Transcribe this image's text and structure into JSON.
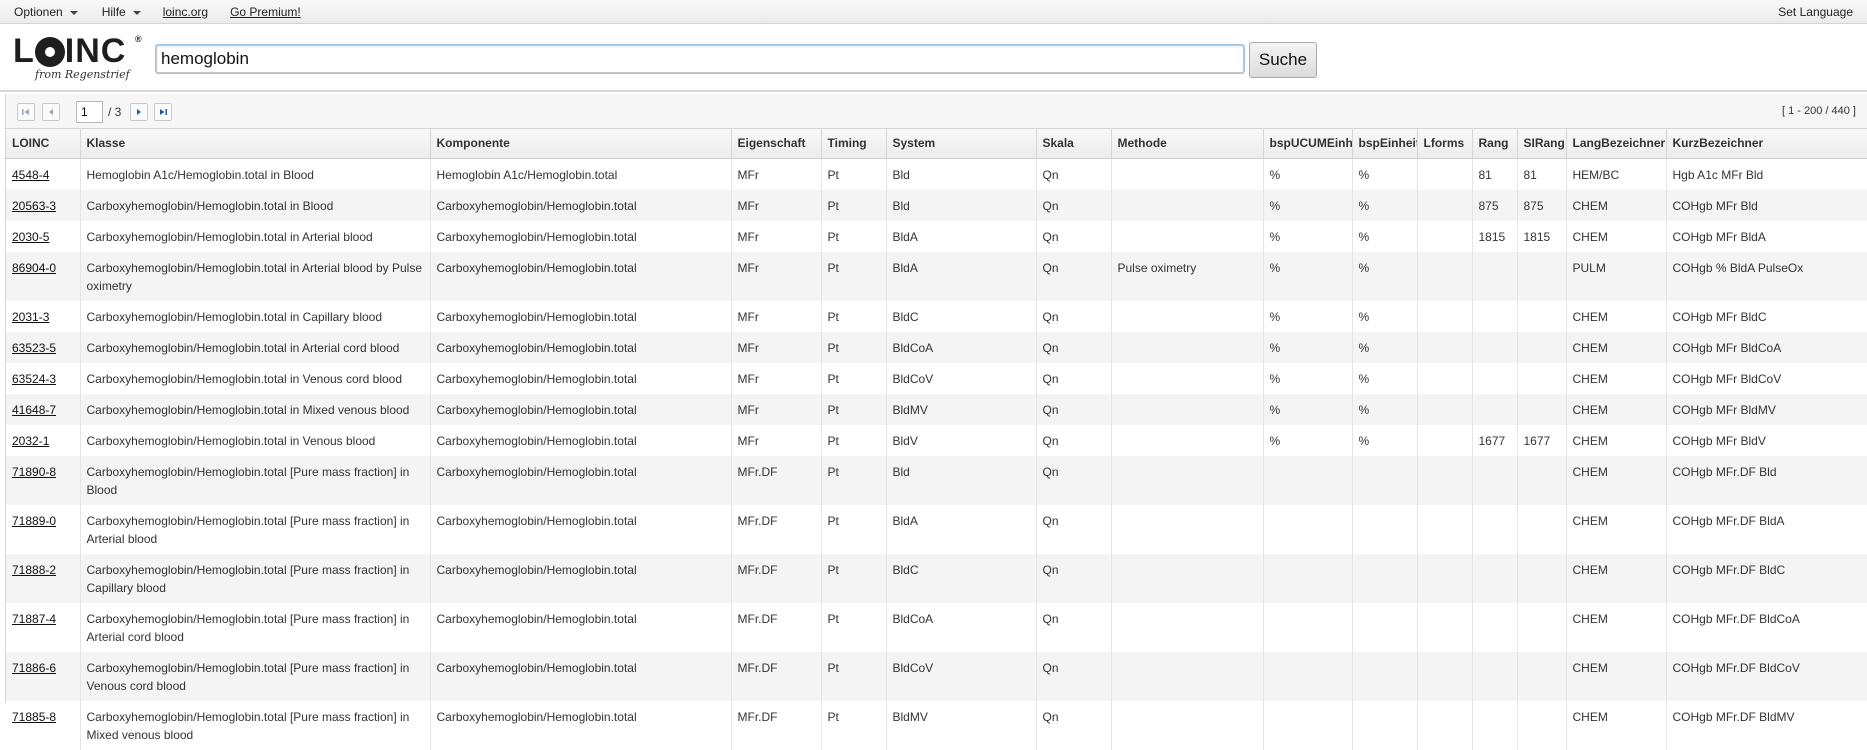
{
  "menu": {
    "optionen": "Optionen",
    "hilfe": "Hilfe",
    "loinc_link": "loinc.org",
    "premium_link": "Go Premium!",
    "set_language": "Set Language"
  },
  "logo": {
    "text_l": "L",
    "text_inc": "INC",
    "reg": "®",
    "sub": "from Regenstrief"
  },
  "search": {
    "value": "hemoglobin",
    "button": "Suche"
  },
  "pager": {
    "page": "1",
    "total": "/ 3",
    "range": "[ 1 - 200 / 440 ]"
  },
  "columns": [
    "LOINC",
    "Klasse",
    "Komponente",
    "Eigenschaft",
    "Timing",
    "System",
    "Skala",
    "Methode",
    "bspUCUMEinheiten",
    "bspEinheiten",
    "Lforms",
    "Rang",
    "SIRang",
    "LangBezeichner",
    "KurzBezeichner"
  ],
  "rows": [
    [
      "4548-4",
      "Hemoglobin A1c/Hemoglobin.total in Blood",
      "Hemoglobin A1c/Hemoglobin.total",
      "MFr",
      "Pt",
      "Bld",
      "Qn",
      "",
      "%",
      "%",
      "",
      "81",
      "81",
      "HEM/BC",
      "Hgb A1c MFr Bld"
    ],
    [
      "20563-3",
      "Carboxyhemoglobin/Hemoglobin.total in Blood",
      "Carboxyhemoglobin/Hemoglobin.total",
      "MFr",
      "Pt",
      "Bld",
      "Qn",
      "",
      "%",
      "%",
      "",
      "875",
      "875",
      "CHEM",
      "COHgb MFr Bld"
    ],
    [
      "2030-5",
      "Carboxyhemoglobin/Hemoglobin.total in Arterial blood",
      "Carboxyhemoglobin/Hemoglobin.total",
      "MFr",
      "Pt",
      "BldA",
      "Qn",
      "",
      "%",
      "%",
      "",
      "1815",
      "1815",
      "CHEM",
      "COHgb MFr BldA"
    ],
    [
      "86904-0",
      "Carboxyhemoglobin/Hemoglobin.total in Arterial blood by Pulse oximetry",
      "Carboxyhemoglobin/Hemoglobin.total",
      "MFr",
      "Pt",
      "BldA",
      "Qn",
      "Pulse oximetry",
      "%",
      "%",
      "",
      "",
      "",
      "PULM",
      "COHgb % BldA PulseOx"
    ],
    [
      "2031-3",
      "Carboxyhemoglobin/Hemoglobin.total in Capillary blood",
      "Carboxyhemoglobin/Hemoglobin.total",
      "MFr",
      "Pt",
      "BldC",
      "Qn",
      "",
      "%",
      "%",
      "",
      "",
      "",
      "CHEM",
      "COHgb MFr BldC"
    ],
    [
      "63523-5",
      "Carboxyhemoglobin/Hemoglobin.total in Arterial cord blood",
      "Carboxyhemoglobin/Hemoglobin.total",
      "MFr",
      "Pt",
      "BldCoA",
      "Qn",
      "",
      "%",
      "%",
      "",
      "",
      "",
      "CHEM",
      "COHgb MFr BldCoA"
    ],
    [
      "63524-3",
      "Carboxyhemoglobin/Hemoglobin.total in Venous cord blood",
      "Carboxyhemoglobin/Hemoglobin.total",
      "MFr",
      "Pt",
      "BldCoV",
      "Qn",
      "",
      "%",
      "%",
      "",
      "",
      "",
      "CHEM",
      "COHgb MFr BldCoV"
    ],
    [
      "41648-7",
      "Carboxyhemoglobin/Hemoglobin.total in Mixed venous blood",
      "Carboxyhemoglobin/Hemoglobin.total",
      "MFr",
      "Pt",
      "BldMV",
      "Qn",
      "",
      "%",
      "%",
      "",
      "",
      "",
      "CHEM",
      "COHgb MFr BldMV"
    ],
    [
      "2032-1",
      "Carboxyhemoglobin/Hemoglobin.total in Venous blood",
      "Carboxyhemoglobin/Hemoglobin.total",
      "MFr",
      "Pt",
      "BldV",
      "Qn",
      "",
      "%",
      "%",
      "",
      "1677",
      "1677",
      "CHEM",
      "COHgb MFr BldV"
    ],
    [
      "71890-8",
      "Carboxyhemoglobin/Hemoglobin.total [Pure mass fraction] in Blood",
      "Carboxyhemoglobin/Hemoglobin.total",
      "MFr.DF",
      "Pt",
      "Bld",
      "Qn",
      "",
      "",
      "",
      "",
      "",
      "",
      "CHEM",
      "COHgb MFr.DF Bld"
    ],
    [
      "71889-0",
      "Carboxyhemoglobin/Hemoglobin.total [Pure mass fraction] in Arterial blood",
      "Carboxyhemoglobin/Hemoglobin.total",
      "MFr.DF",
      "Pt",
      "BldA",
      "Qn",
      "",
      "",
      "",
      "",
      "",
      "",
      "CHEM",
      "COHgb MFr.DF BldA"
    ],
    [
      "71888-2",
      "Carboxyhemoglobin/Hemoglobin.total [Pure mass fraction] in Capillary blood",
      "Carboxyhemoglobin/Hemoglobin.total",
      "MFr.DF",
      "Pt",
      "BldC",
      "Qn",
      "",
      "",
      "",
      "",
      "",
      "",
      "CHEM",
      "COHgb MFr.DF BldC"
    ],
    [
      "71887-4",
      "Carboxyhemoglobin/Hemoglobin.total [Pure mass fraction] in Arterial cord blood",
      "Carboxyhemoglobin/Hemoglobin.total",
      "MFr.DF",
      "Pt",
      "BldCoA",
      "Qn",
      "",
      "",
      "",
      "",
      "",
      "",
      "CHEM",
      "COHgb MFr.DF BldCoA"
    ],
    [
      "71886-6",
      "Carboxyhemoglobin/Hemoglobin.total [Pure mass fraction] in Venous cord blood",
      "Carboxyhemoglobin/Hemoglobin.total",
      "MFr.DF",
      "Pt",
      "BldCoV",
      "Qn",
      "",
      "",
      "",
      "",
      "",
      "",
      "CHEM",
      "COHgb MFr.DF BldCoV"
    ],
    [
      "71885-8",
      "Carboxyhemoglobin/Hemoglobin.total [Pure mass fraction] in Mixed venous blood",
      "Carboxyhemoglobin/Hemoglobin.total",
      "MFr.DF",
      "Pt",
      "BldMV",
      "Qn",
      "",
      "",
      "",
      "",
      "",
      "",
      "CHEM",
      "COHgb MFr.DF BldMV"
    ]
  ]
}
